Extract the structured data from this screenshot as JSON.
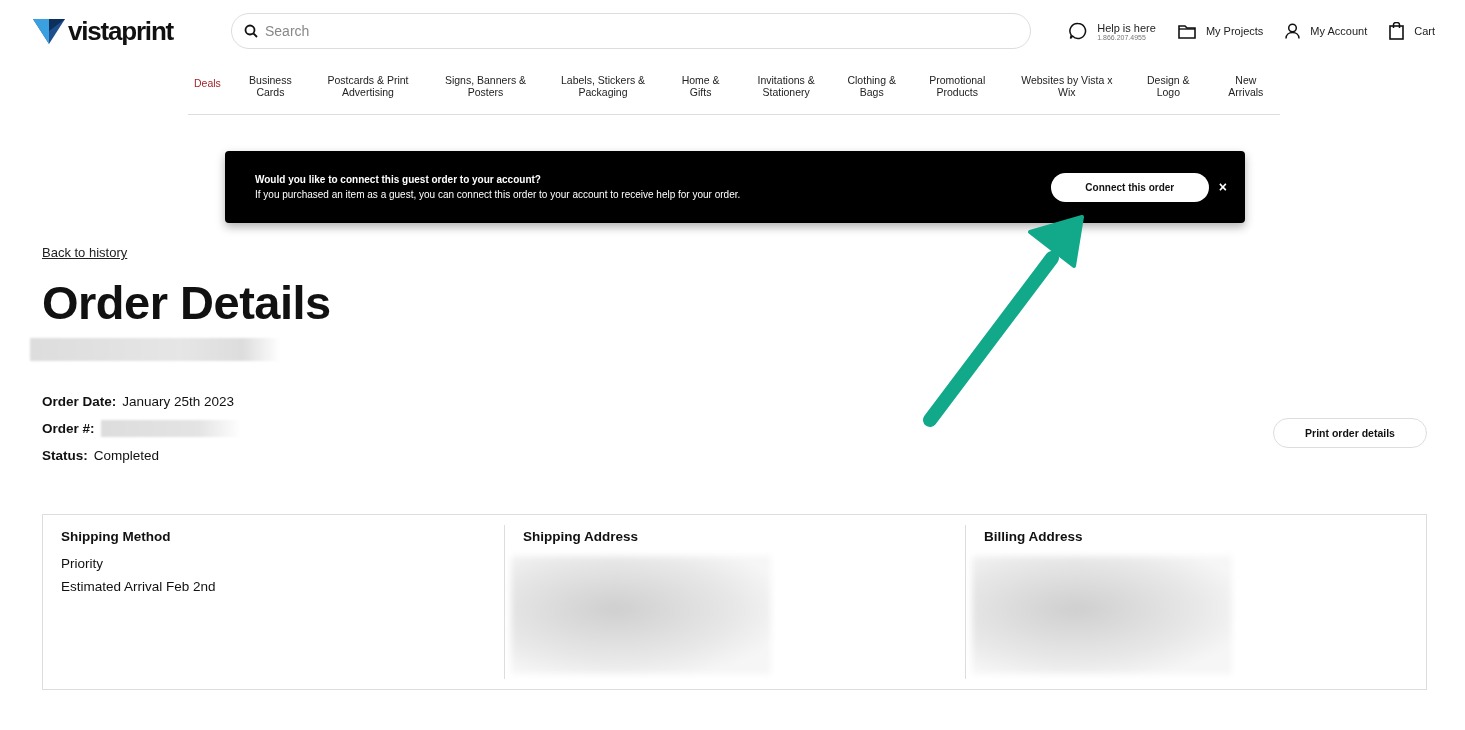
{
  "header": {
    "logo": "vistaprint",
    "search": {
      "placeholder": "Search"
    },
    "help": {
      "label": "Help is here",
      "phone": "1.866.207.4955"
    },
    "links": [
      {
        "kind": "projects",
        "label": "My Projects"
      },
      {
        "kind": "account",
        "label": "My Account"
      },
      {
        "kind": "cart",
        "label": "Cart"
      }
    ]
  },
  "nav": [
    {
      "label": "Deals",
      "kind": "promo"
    },
    {
      "label": "Business Cards",
      "kind": "category"
    },
    {
      "label": "Postcards & Print Advertising",
      "kind": "category"
    },
    {
      "label": "Signs, Banners & Posters",
      "kind": "category"
    },
    {
      "label": "Labels, Stickers & Packaging",
      "kind": "category"
    },
    {
      "label": "Home & Gifts",
      "kind": "category"
    },
    {
      "label": "Invitations & Stationery",
      "kind": "category"
    },
    {
      "label": "Clothing & Bags",
      "kind": "category"
    },
    {
      "label": "Promotional Products",
      "kind": "category"
    },
    {
      "label": "Websites by Vista x Wix",
      "kind": "category"
    },
    {
      "label": "Design & Logo",
      "kind": "category"
    },
    {
      "label": "New Arrivals",
      "kind": "category"
    }
  ],
  "banner": {
    "title": "Would you like to connect this guest order to your account?",
    "message": "If you purchased an item as a guest, you can connect this order to your account to receive help for your order.",
    "button": "Connect this order",
    "close": "×"
  },
  "back_link": "Back to history",
  "title": "Order Details",
  "fields": [
    {
      "label": "Order Date:",
      "value": "January 25th 2023"
    },
    {
      "label": "Order #:"
    },
    {
      "label": "Status:",
      "value": "Completed"
    }
  ],
  "print_button": "Print order details",
  "sections": [
    {
      "title": "Shipping Method",
      "lines": [
        "Priority",
        "Estimated Arrival Feb 2nd"
      ]
    },
    {
      "title": "Shipping Address",
      "redacted": true
    },
    {
      "title": "Billing Address",
      "redacted": true
    }
  ]
}
